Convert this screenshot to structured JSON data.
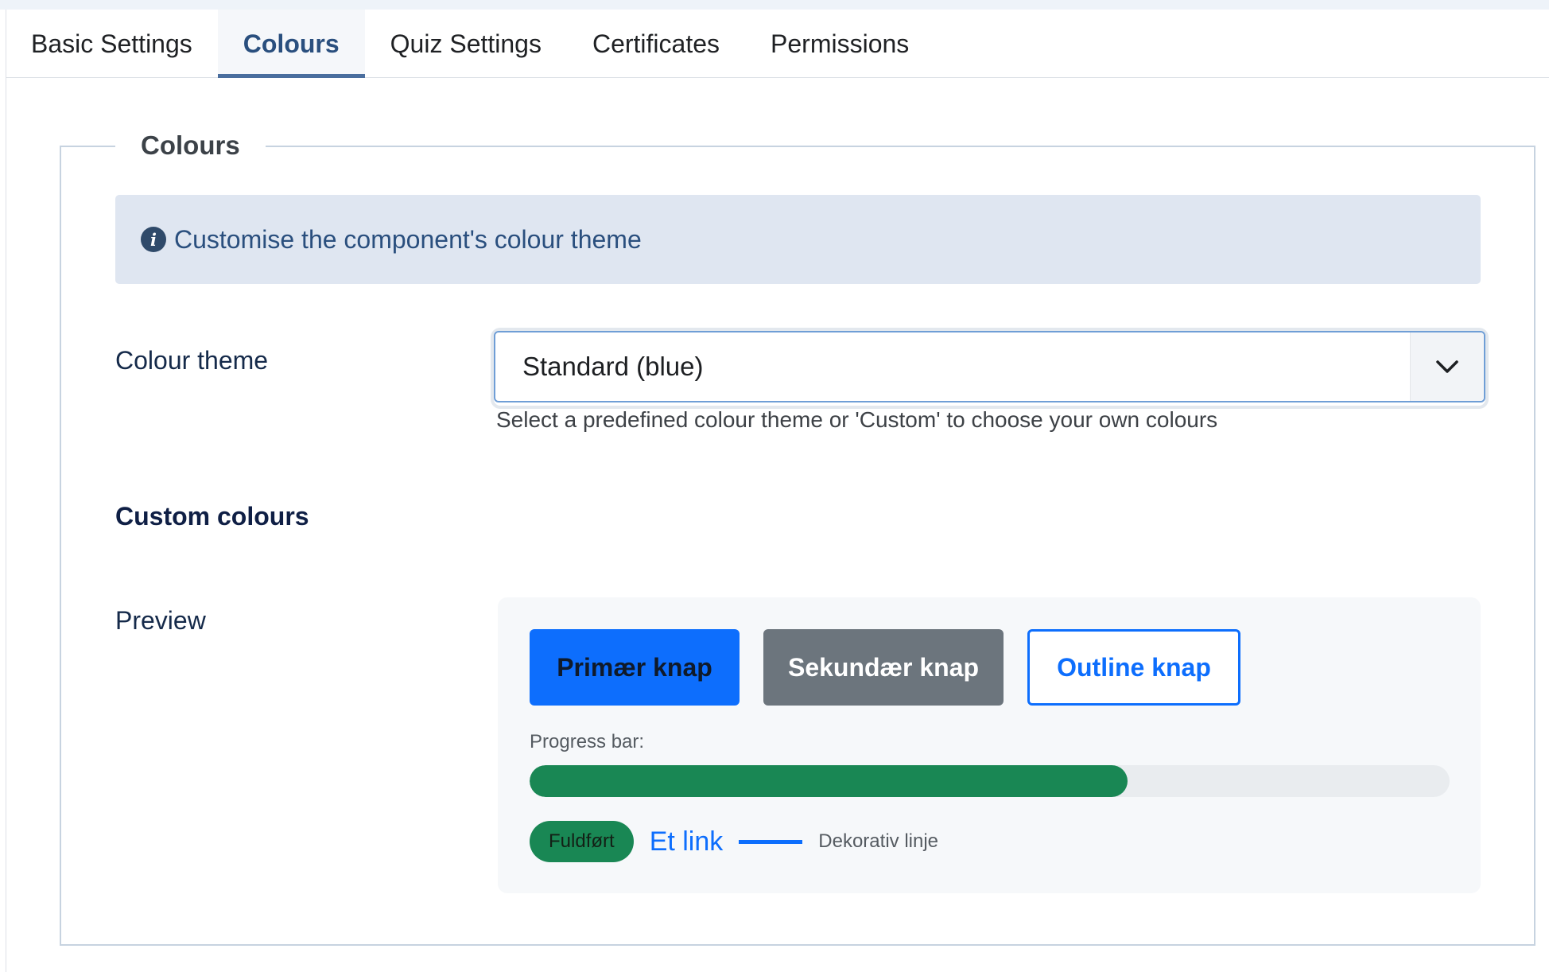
{
  "tabs": [
    {
      "label": "Basic Settings",
      "active": false
    },
    {
      "label": "Colours",
      "active": true
    },
    {
      "label": "Quiz Settings",
      "active": false
    },
    {
      "label": "Certificates",
      "active": false
    },
    {
      "label": "Permissions",
      "active": false
    }
  ],
  "fieldset": {
    "legend": "Colours",
    "info_text": "Customise the component's colour theme",
    "info_icon": "info-circle-icon"
  },
  "colour_theme": {
    "label": "Colour theme",
    "selected": "Standard (blue)",
    "help": "Select a predefined colour theme or 'Custom' to choose your own colours"
  },
  "custom_colours": {
    "heading": "Custom colours"
  },
  "preview": {
    "label": "Preview",
    "primary_button": "Primær knap",
    "secondary_button": "Sekundær knap",
    "outline_button": "Outline knap",
    "progress_label": "Progress bar:",
    "progress_fraction": 0.65,
    "badge": "Fuldført",
    "link": "Et link",
    "decorative_text": "Dekorativ linje"
  },
  "colors": {
    "primary": "#0d6efd",
    "secondary": "#6c757d",
    "success": "#198754",
    "alert_bg": "#dfe6f1",
    "tab_active": "#2a4f7e"
  }
}
